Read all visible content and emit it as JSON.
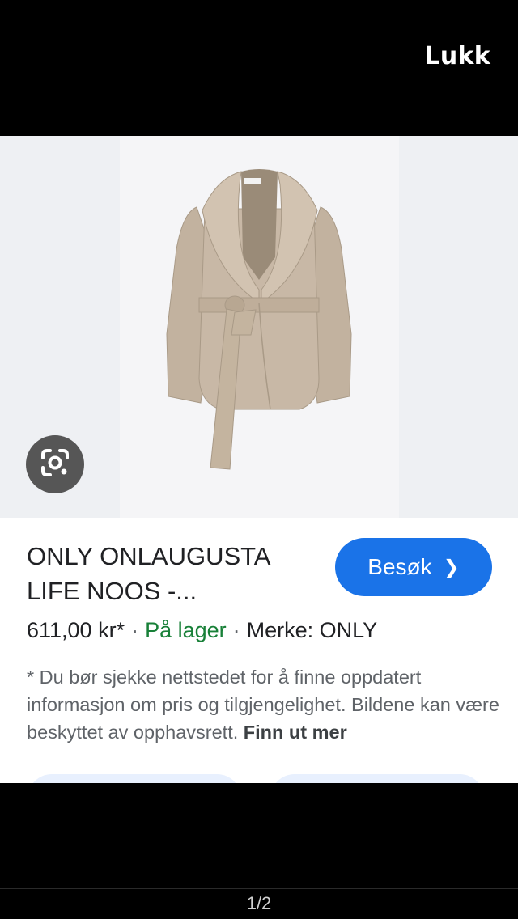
{
  "header": {
    "close_label": "Lukk"
  },
  "product": {
    "title": "ONLY ONLAUGUSTA LIFE NOOS -...",
    "price": "611,00 kr*",
    "stock": "På lager",
    "brand": "Merke: ONLY",
    "visit_label": "Besøk",
    "visit_icon": "chevron-right-icon",
    "disclaimer": "* Du bør sjekke nettstedet for å finne oppdatert informasjon om pris og tilgjengelighet. Bildene kan være beskyttet av opphavsrett.",
    "learn_more": "Finn ut mer"
  },
  "image": {
    "lens_icon": "google-lens-icon"
  },
  "colors": {
    "accent": "#1a73e8",
    "stock_green": "#188038",
    "coat": "#c8b8a6"
  },
  "pager": {
    "text": "1/2"
  }
}
